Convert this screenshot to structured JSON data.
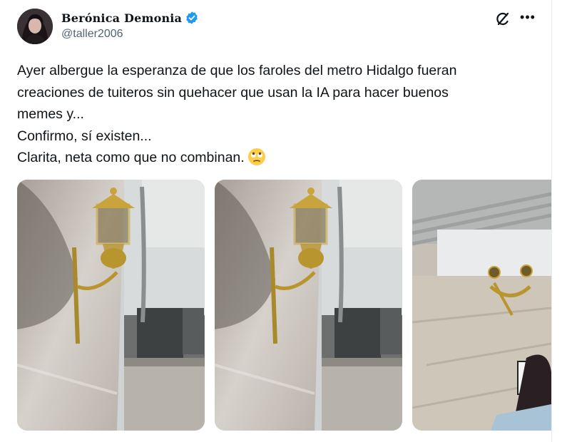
{
  "author": {
    "display_name": "Berónica Demonia",
    "handle": "@taller2006",
    "verified": true,
    "avatar_icon": "profile-photo"
  },
  "actions": {
    "grok_icon": "grok-icon",
    "more_label": "•••"
  },
  "tweet": {
    "lines": [
      "Ayer albergue la esperanza de que los faroles del metro Hidalgo fueran",
      "creaciones de tuiteros sin quehacer que usan la IA para hacer buenos",
      "memes y...",
      "Confirmo, sí existen...",
      "Clarita, neta como que no combinan."
    ],
    "emoji": "face-with-rolling-eyes"
  },
  "media": {
    "photos": [
      {
        "icon": "lamp-photo-1"
      },
      {
        "icon": "lamp-photo-2"
      },
      {
        "icon": "lamp-photo-3"
      }
    ]
  },
  "colors": {
    "text_primary": "#0f1419",
    "text_secondary": "#536471",
    "verified_blue": "#1d9bf0"
  }
}
